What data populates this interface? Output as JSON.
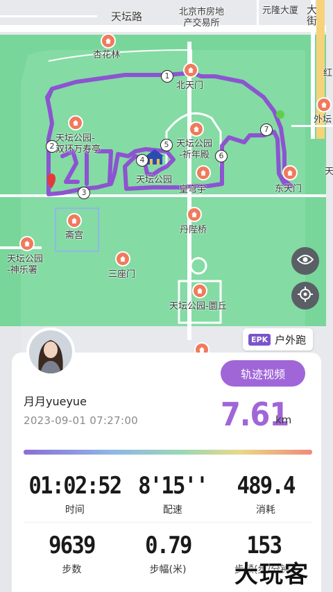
{
  "map": {
    "labels": {
      "tiantan_road": "天坛路",
      "real_estate": "北京市房地\n产交易所",
      "yuanlong": "元隆大厦",
      "dajie": "大\n街",
      "hong": "红",
      "xinghuahin": "杏花林",
      "north_gate": "北天门",
      "waitan": "外坛",
      "park_shuanghuan": "天坛公园-\n双环万寿亭",
      "qiniandian": "天坛公园\n-祈年殿",
      "tiantan_park": "天坛公园",
      "huangqiongyu": "皇穹宇",
      "east_gate": "东天门",
      "zhaigong": "斋宫",
      "danbiqiao": "丹陛桥",
      "shenyueshu": "天坛公园\n-神乐署",
      "sanzuomen": "三座门",
      "yuanqiu": "天坛公园-圜丘",
      "tian": "天"
    },
    "route_color": "#8e45d6",
    "waypoints": [
      "1",
      "2",
      "3",
      "4",
      "5",
      "6",
      "7"
    ]
  },
  "controls": {
    "eye_icon": "eye-icon",
    "locate_icon": "locate-icon"
  },
  "sport": {
    "badge": "EPK",
    "type": "户外跑"
  },
  "user": {
    "name": "月月yueyue",
    "datetime": "2023-09-01 07:27:00"
  },
  "track_button": "轨迹视频",
  "distance": {
    "value": "7.61",
    "unit": "km"
  },
  "stats": [
    {
      "value": "01:02:52",
      "label": "时间"
    },
    {
      "value": "8'15''",
      "label": "配速"
    },
    {
      "value": "489.4",
      "label": "消耗"
    },
    {
      "value": "9639",
      "label": "步数"
    },
    {
      "value": "0.79",
      "label": "步幅(米)"
    },
    {
      "value": "153",
      "label": "步频(步/分钟)"
    }
  ],
  "watermark": "大玩客",
  "colors": {
    "accent": "#a066d8",
    "park_green": "#6fcf8f",
    "poi": "#f07a5d"
  }
}
